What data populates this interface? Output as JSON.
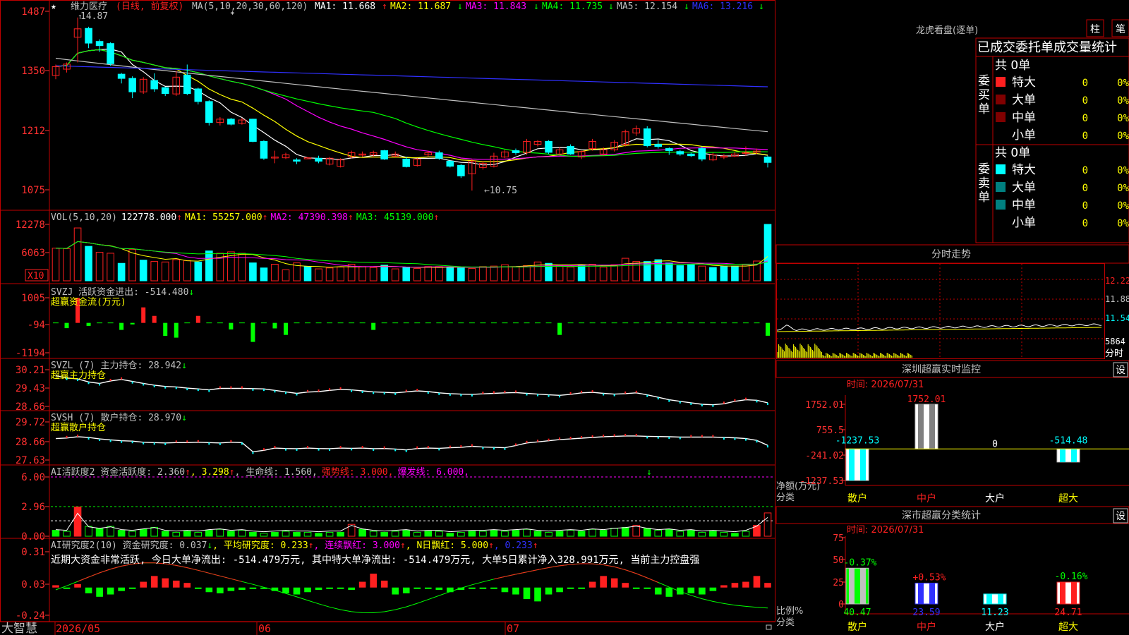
{
  "colors": {
    "up": "#ff2020",
    "down": "#00ffff",
    "frame": "#c00000",
    "axis": "#ff3030",
    "white": "#ffffff",
    "yellow": "#ffff00",
    "magenta": "#ff00ff",
    "green": "#00ff00",
    "blue": "#3030ff",
    "gray": "#c0c0c0",
    "dkred": "#800000",
    "teal": "#008080"
  },
  "header": {
    "star": "★",
    "title": "维力医疗",
    "mode": "(日线, 前复权)",
    "ma_params": "MA(5,10,20,30,60,120)",
    "ma1": "MA1: 11.668",
    "ma1_arrow": "↑",
    "ma2": "MA2: 11.687",
    "ma2_arrow": "↓",
    "ma3": "MA3: 11.843",
    "ma3_arrow": "↓",
    "ma4": "MA4: 11.735",
    "ma4_arrow": "↓",
    "ma5": "MA5: 12.154",
    "ma5_arrow": "↓",
    "ma6": "MA6: 13.216",
    "ma6_arrow": "↓"
  },
  "price": {
    "high_label": "14.87",
    "low_label": "←10.75",
    "high_arrow": "↑"
  },
  "vol_panel": {
    "title": "VOL(5,10,20)",
    "val": "122778.000",
    "arr": "↑",
    "ma1": "MA1: 55257.000",
    "ma1_arr": "↑",
    "ma2": "MA2: 47390.398",
    "ma2_arr": "↑",
    "ma3": "MA3: 45139.000",
    "ma3_arr": "↑",
    "unit": "X10"
  },
  "svzj_panel": {
    "title": "SVZJ  活跃资金进出: -514.480",
    "arr": "↓",
    "sub": "超赢资金流(万元)"
  },
  "svzl_panel": {
    "title": "SVZL (7) 主力持仓: 28.942",
    "arr": "↓",
    "sub": "超赢主力持仓"
  },
  "svsh_panel": {
    "title": "SVSH (7) 散户持仓: 28.970",
    "arr": "↓",
    "sub": "超赢散户持仓"
  },
  "ai1_panel": {
    "title": "AI活跃度2 资金活跃度: 2.360",
    "a1": "↑",
    "v2": ", 3.298",
    "a2": "↑",
    "v3": ", 生命线: 1.560,",
    "v4": "强势线: 3.000,",
    "v5": "爆发线: 6.000,"
  },
  "ai2_panel": {
    "title": "AI研究度2(10) 资金研究度: 0.037",
    "a1": "↓",
    "l2": ", 平均研究度: 0.233",
    "a2": "↑",
    "l3": ", 连续飘红: 3.000",
    "a3": "↑",
    "l4": ", N日飘红: 5.000",
    "a4": "↑",
    "l5": ", 0.233",
    "a5": "↑",
    "comment": "近期大资金非常活跃, 今日大单净流出: -514.479万元, 其中特大单净流出: -514.479万元, 大单5日累计净入328.991万元, 当前主力控盘强"
  },
  "bottom": {
    "brand": "大智慧",
    "d1": "2026/05",
    "d2": "06",
    "d3": "07"
  },
  "right": {
    "dragon_title": "龙虎看盘(逐单)",
    "btn_bar": "柱",
    "btn_stroke": "笔",
    "tabs": [
      "已成交",
      "委托单",
      "成交量统计"
    ],
    "buy": {
      "side": "委买单",
      "count": "共 0单",
      "rows": [
        {
          "label": "特大",
          "n": "0",
          "p": "0%"
        },
        {
          "label": "大单",
          "n": "0",
          "p": "0%"
        },
        {
          "label": "中单",
          "n": "0",
          "p": "0%"
        },
        {
          "label": "小单",
          "n": "0",
          "p": "0%"
        }
      ]
    },
    "sell": {
      "side": "委卖单",
      "count": "共 0单",
      "rows": [
        {
          "label": "特大",
          "n": "0",
          "p": "0%"
        },
        {
          "label": "大单",
          "n": "0",
          "p": "0%"
        },
        {
          "label": "中单",
          "n": "0",
          "p": "0%"
        },
        {
          "label": "小单",
          "n": "0",
          "p": "0%"
        }
      ]
    },
    "intraday": {
      "title": "分时走势",
      "ticks": [
        "12.22",
        "11.88",
        "11.54",
        "5864"
      ],
      "unit": "分时"
    },
    "monitor": {
      "title": "深圳超赢实时监控",
      "btn": "设",
      "time": "时间: 2026/07/31",
      "yticks": [
        "1752.01",
        "755.5",
        "-241.02",
        "-1237.53"
      ],
      "ylabel": "净额(万元)",
      "xlabel": "分类"
    },
    "stats": {
      "title": "深市超赢分类统计",
      "btn": "设",
      "time": "时间: 2026/07/31",
      "yticks": [
        "75",
        "50",
        "25",
        "0"
      ],
      "ylabel": "比例%",
      "xlabel": "分类"
    }
  },
  "chart_data": [
    {
      "type": "candlestick",
      "title": "维力医疗",
      "yticks": [
        "1487",
        "1350",
        "1212",
        "1075"
      ],
      "ylim": [
        10.5,
        14.95
      ],
      "candles": [
        [
          13.49,
          13.7,
          13.4,
          13.75
        ],
        [
          13.64,
          13.76,
          13.56,
          13.8
        ],
        [
          14.4,
          14.6,
          13.8,
          14.87
        ],
        [
          14.61,
          14.26,
          14.14,
          14.65
        ],
        [
          14.3,
          14.2,
          14.05,
          14.35
        ],
        [
          14.25,
          13.77,
          13.72,
          14.28
        ],
        [
          13.52,
          13.42,
          13.3,
          13.55
        ],
        [
          13.42,
          13.1,
          12.95,
          13.47
        ],
        [
          13.1,
          13.4,
          13.05,
          13.45
        ],
        [
          13.37,
          13.17,
          13.1,
          13.54
        ],
        [
          13.2,
          13.06,
          13.0,
          13.22
        ],
        [
          13.05,
          13.45,
          13.0,
          13.6
        ],
        [
          13.5,
          13.06,
          13.02,
          13.75
        ],
        [
          13.17,
          12.87,
          12.8,
          13.2
        ],
        [
          12.87,
          12.37,
          12.3,
          12.9
        ],
        [
          12.37,
          12.45,
          12.3,
          12.5
        ],
        [
          12.45,
          12.33,
          12.3,
          12.48
        ],
        [
          12.35,
          12.43,
          12.32,
          12.48
        ],
        [
          12.45,
          11.92,
          11.9,
          12.46
        ],
        [
          11.92,
          11.52,
          11.48,
          11.95
        ],
        [
          11.55,
          11.55,
          11.4,
          11.7
        ],
        [
          11.53,
          11.6,
          11.5,
          11.65
        ],
        [
          11.48,
          11.45,
          11.38,
          11.52
        ],
        [
          11.52,
          11.53,
          11.5,
          11.55
        ],
        [
          11.52,
          11.45,
          11.4,
          11.58
        ],
        [
          11.38,
          11.52,
          11.35,
          11.55
        ],
        [
          11.33,
          11.48,
          11.3,
          11.52
        ],
        [
          11.55,
          11.65,
          11.52,
          11.7
        ],
        [
          11.6,
          11.62,
          11.55,
          11.68
        ],
        [
          11.6,
          11.65,
          11.55,
          11.7
        ],
        [
          11.7,
          11.5,
          11.48,
          11.72
        ],
        [
          11.57,
          11.62,
          11.55,
          11.68
        ],
        [
          11.5,
          11.32,
          11.3,
          11.55
        ],
        [
          11.35,
          11.5,
          11.32,
          11.52
        ],
        [
          11.6,
          11.65,
          11.55,
          11.7
        ],
        [
          11.65,
          11.52,
          11.48,
          11.7
        ],
        [
          11.45,
          11.33,
          11.3,
          11.48
        ],
        [
          11.35,
          11.1,
          11.05,
          11.38
        ],
        [
          11.15,
          11.45,
          10.75,
          11.5
        ],
        [
          11.3,
          11.4,
          11.25,
          11.45
        ],
        [
          11.33,
          11.57,
          11.3,
          11.65
        ],
        [
          11.55,
          11.67,
          11.52,
          11.72
        ],
        [
          11.7,
          11.65,
          11.6,
          11.75
        ],
        [
          11.65,
          11.92,
          11.6,
          11.98
        ],
        [
          11.85,
          11.92,
          11.8,
          11.95
        ],
        [
          11.92,
          11.66,
          11.62,
          11.95
        ],
        [
          11.62,
          11.72,
          11.6,
          11.78
        ],
        [
          11.8,
          11.62,
          11.6,
          11.85
        ],
        [
          11.55,
          11.68,
          11.5,
          11.7
        ],
        [
          11.75,
          11.92,
          11.7,
          11.98
        ],
        [
          11.62,
          11.72,
          11.58,
          11.78
        ],
        [
          11.72,
          11.9,
          11.68,
          11.95
        ],
        [
          11.85,
          12.15,
          11.8,
          12.2
        ],
        [
          12.12,
          12.22,
          12.05,
          12.3
        ],
        [
          12.22,
          11.82,
          11.78,
          12.28
        ],
        [
          11.85,
          11.8,
          11.75,
          11.95
        ],
        [
          11.75,
          11.7,
          11.6,
          11.78
        ],
        [
          11.68,
          11.62,
          11.58,
          11.72
        ],
        [
          11.62,
          11.58,
          11.55,
          11.65
        ],
        [
          11.75,
          11.5,
          11.45,
          11.8
        ],
        [
          11.48,
          11.6,
          11.45,
          11.65
        ],
        [
          11.55,
          11.57,
          11.5,
          11.62
        ],
        [
          11.57,
          11.62,
          11.55,
          11.68
        ],
        [
          11.65,
          11.66,
          11.58,
          11.8
        ],
        [
          11.67,
          11.69,
          11.62,
          11.75
        ],
        [
          11.55,
          11.42,
          11.3,
          11.58
        ]
      ]
    },
    {
      "type": "bar",
      "title": "VOL(5,10,20)",
      "yticks": [
        "12278",
        "6063"
      ],
      "ylim": [
        0,
        12278
      ],
      "values": [
        7100,
        7000,
        11500,
        7500,
        6200,
        6000,
        3800,
        6800,
        4500,
        4200,
        4100,
        4600,
        4400,
        4100,
        6500,
        6000,
        6300,
        6000,
        3900,
        2800,
        3600,
        2400,
        3900,
        3100,
        2600,
        2800,
        3000,
        3600,
        3100,
        2900,
        3400,
        2600,
        3000,
        2700,
        3100,
        3100,
        3000,
        2800,
        2700,
        3100,
        3200,
        3500,
        3000,
        3300,
        4100,
        3800,
        3300,
        3000,
        3500,
        3600,
        3000,
        3500,
        4900,
        4200,
        4200,
        4600,
        3900,
        3300,
        3500,
        3200,
        2900,
        3200,
        3200,
        3500,
        4300,
        12278
      ],
      "up": [
        1,
        1,
        1,
        0,
        1,
        1,
        0,
        1,
        0,
        1,
        1,
        1,
        1,
        0,
        0,
        1,
        1,
        1,
        0,
        0,
        1,
        1,
        1,
        0,
        1,
        1,
        1,
        1,
        1,
        1,
        0,
        1,
        0,
        1,
        1,
        1,
        0,
        0,
        1,
        1,
        1,
        1,
        1,
        1,
        1,
        0,
        1,
        1,
        0,
        1,
        1,
        1,
        1,
        1,
        0,
        0,
        0,
        0,
        0,
        1,
        0,
        0,
        0,
        1,
        1,
        0
      ],
      "ma_series": [
        "MA1",
        "MA2",
        "MA3"
      ]
    },
    {
      "type": "bar",
      "title": "SVZJ",
      "yticks": [
        "1005",
        "-94",
        "-1194"
      ],
      "ylim": [
        -1194,
        1005
      ],
      "values": [
        0,
        -210,
        1005,
        -120,
        0,
        0,
        -280,
        -60,
        620,
        280,
        -520,
        -590,
        0,
        280,
        0,
        0,
        -260,
        0,
        -760,
        0,
        -220,
        -480,
        0,
        0,
        0,
        0,
        0,
        0,
        0,
        -280,
        0,
        0,
        0,
        0,
        0,
        0,
        0,
        0,
        0,
        0,
        0,
        0,
        0,
        0,
        0,
        0,
        -480,
        0,
        0,
        0,
        0,
        0,
        0,
        0,
        0,
        0,
        0,
        0,
        0,
        0,
        0,
        0,
        0,
        0,
        0,
        -514
      ]
    },
    {
      "type": "line",
      "title": "SVZL",
      "yticks": [
        "30.21",
        "29.43",
        "28.66"
      ],
      "ylim": [
        28.6,
        30.25
      ],
      "values": [
        29.95,
        29.86,
        29.82,
        29.7,
        29.64,
        29.74,
        29.8,
        29.72,
        29.64,
        29.57,
        29.52,
        29.5,
        29.45,
        29.42,
        29.38,
        29.44,
        29.44,
        29.44,
        29.43,
        29.42,
        29.36,
        29.3,
        29.24,
        29.29,
        29.31,
        29.36,
        29.4,
        29.38,
        29.34,
        29.3,
        29.28,
        29.26,
        29.3,
        29.34,
        29.31,
        29.26,
        29.23,
        29.21,
        29.2,
        29.22,
        29.24,
        29.26,
        29.27,
        29.24,
        29.21,
        29.18,
        29.16,
        29.2,
        29.26,
        29.28,
        29.24,
        29.21,
        29.23,
        29.26,
        29.18,
        29.08,
        28.98,
        28.92,
        28.86,
        28.8,
        28.78,
        28.82,
        28.92,
        28.98,
        28.96,
        28.86
      ]
    },
    {
      "type": "line",
      "title": "SVSH",
      "yticks": [
        "29.72",
        "28.66",
        "27.63"
      ],
      "ylim": [
        27.5,
        29.8
      ],
      "values": [
        28.82,
        28.85,
        28.92,
        28.88,
        28.8,
        28.75,
        28.7,
        28.68,
        28.62,
        28.6,
        28.58,
        28.6,
        28.6,
        28.62,
        28.6,
        28.58,
        28.62,
        28.6,
        28.1,
        28.18,
        28.3,
        28.28,
        28.27,
        28.3,
        28.28,
        28.27,
        28.3,
        28.29,
        28.3,
        28.27,
        28.28,
        28.25,
        28.2,
        28.28,
        28.3,
        28.29,
        28.32,
        28.34,
        28.4,
        28.36,
        28.34,
        28.32,
        28.44,
        28.58,
        28.64,
        28.7,
        28.76,
        28.8,
        28.84,
        28.88,
        28.92,
        28.94,
        28.96,
        28.96,
        28.94,
        28.93,
        28.92,
        28.9,
        28.9,
        28.9,
        28.9,
        28.88,
        28.86,
        28.82,
        28.72,
        28.45
      ]
    },
    {
      "type": "bar",
      "title": "AI活跃度2",
      "yticks": [
        "6.00",
        "2.96",
        "0.00"
      ],
      "ylim": [
        0,
        6
      ],
      "values": [
        0.6,
        0.5,
        2.96,
        1.0,
        0.8,
        1.0,
        0.6,
        0.5,
        0.7,
        0.9,
        0.5,
        0.4,
        0.5,
        0.4,
        0.6,
        0.7,
        0.5,
        0.6,
        0.4,
        0.3,
        0.4,
        0.5,
        0.4,
        0.4,
        0.3,
        0.4,
        0.4,
        1.2,
        0.7,
        0.5,
        0.4,
        0.5,
        0.6,
        0.4,
        0.5,
        0.5,
        0.3,
        0.4,
        0.5,
        0.5,
        0.6,
        0.5,
        0.6,
        0.7,
        0.5,
        0.4,
        0.5,
        0.6,
        0.5,
        0.7,
        0.6,
        0.8,
        0.9,
        1.1,
        0.8,
        0.6,
        0.7,
        0.5,
        0.6,
        0.4,
        0.5,
        0.4,
        0.3,
        0.5,
        1.1,
        2.36
      ],
      "lines": {
        "生命线": 1.56,
        "强势线": 3.0,
        "爆发线": 6.0
      }
    },
    {
      "type": "bar",
      "title": "AI研究度2(10)",
      "yticks": [
        "0.31",
        "0.03",
        "-0.24"
      ],
      "ylim": [
        -0.24,
        0.31
      ],
      "values": [
        0.02,
        0.0,
        0.03,
        -0.05,
        -0.08,
        -0.06,
        -0.03,
        0.0,
        0.05,
        0.1,
        0.08,
        0.06,
        0.04,
        0.0,
        -0.04,
        -0.05,
        -0.03,
        -0.02,
        0.0,
        0.0,
        -0.03,
        -0.05,
        -0.06,
        -0.04,
        -0.02,
        0.0,
        0.0,
        -0.02,
        0.05,
        0.12,
        0.06,
        -0.06,
        -0.05,
        0.0,
        0.0,
        -0.02,
        -0.04,
        -0.02,
        0.0,
        0.0,
        0.0,
        -0.04,
        -0.06,
        -0.1,
        -0.12,
        -0.06,
        -0.04,
        0.0,
        0.0,
        0.05,
        0.1,
        0.08,
        0.04,
        0.0,
        0.0,
        -0.06,
        -0.08,
        -0.06,
        -0.05,
        -0.06,
        -0.03,
        0.02,
        0.04,
        0.05,
        0.1,
        0.04
      ]
    },
    {
      "type": "bar",
      "title": "深圳超赢实时监控",
      "categories": [
        "散户",
        "中户",
        "大户",
        "超大"
      ],
      "values": [
        -1237.53,
        1752.01,
        0,
        -514.48
      ],
      "labels": [
        "-1237.53",
        "1752.01",
        "0",
        "-514.48"
      ]
    },
    {
      "type": "bar",
      "title": "深市超赢分类统计",
      "categories": [
        "散户",
        "中户",
        "大户",
        "超大"
      ],
      "values": [
        40.47,
        23.59,
        11.23,
        24.71
      ],
      "change_labels": [
        "-0.37%",
        "+0.53%",
        "",
        "-0.16%"
      ]
    }
  ]
}
